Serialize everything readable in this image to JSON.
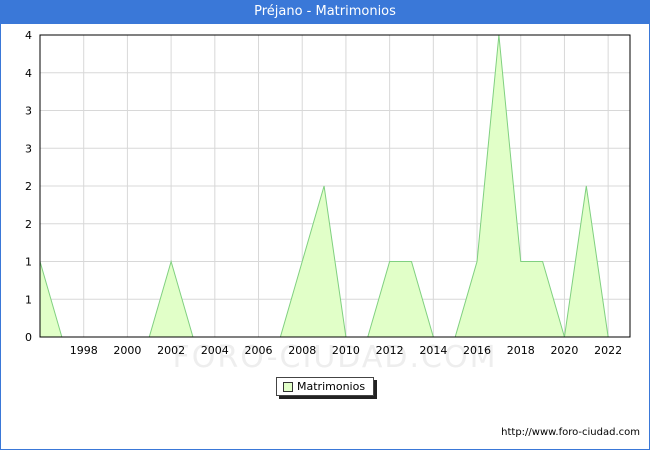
{
  "title": "Préjano - Matrimonios",
  "source_text": "http://www.foro-ciudad.com",
  "watermark_text": "FORO-CIUDAD.COM",
  "colors": {
    "title_bar": "#3a78d8",
    "series_fill": "#e1ffc8",
    "series_line": "#80d080",
    "grid": "#d8d8d8"
  },
  "chart_data": {
    "type": "area",
    "title": "Préjano - Matrimonios",
    "xlabel": "",
    "ylabel": "",
    "xlim": [
      1996,
      2023
    ],
    "ylim": [
      0,
      2
    ],
    "x_ticks": [
      1998,
      2000,
      2002,
      2004,
      2006,
      2008,
      2010,
      2012,
      2014,
      2016,
      2018,
      2020,
      2022
    ],
    "y_ticks": [
      0,
      0.25,
      0.5,
      0.75,
      1,
      1.25,
      1.5,
      1.75,
      2
    ],
    "y_tick_labels": [
      "0",
      "1",
      "1",
      "2",
      "2",
      "3",
      "3",
      "4",
      "4"
    ],
    "grid": true,
    "legend_position": "bottom-center",
    "series": [
      {
        "name": "Matrimonios",
        "x": [
          1996,
          1997,
          1998,
          1999,
          2000,
          2001,
          2002,
          2003,
          2004,
          2005,
          2006,
          2007,
          2008,
          2009,
          2010,
          2011,
          2012,
          2013,
          2014,
          2015,
          2016,
          2017,
          2018,
          2019,
          2020,
          2021,
          2022
        ],
        "values": [
          0.5,
          0,
          0,
          0,
          0,
          0,
          0.5,
          0,
          0,
          0,
          0,
          0,
          0.5,
          1,
          0,
          0,
          0.5,
          0.5,
          0,
          0,
          0.5,
          2,
          0.5,
          0.5,
          0,
          1,
          0
        ]
      }
    ]
  }
}
